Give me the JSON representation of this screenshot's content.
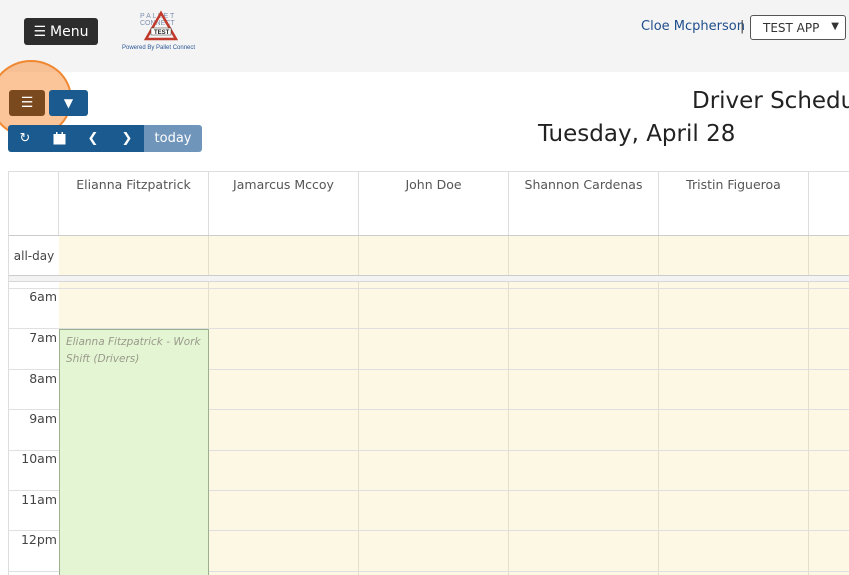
{
  "header": {
    "menu_label": "Menu",
    "logo_lines": [
      "PALLET",
      "CONNECT",
      "TEST"
    ],
    "logo_caption": "Powered By Pallet Connect",
    "user_name": "Cloe Mcpherson",
    "separator": "|",
    "app_select": {
      "selected": "TEST APP"
    }
  },
  "toolbar": {
    "list_icon": "list-icon",
    "filter_icon": "filter-icon",
    "refresh_icon": "refresh-icon",
    "calendar_icon": "calendar-icon",
    "prev_icon": "chevron-left-icon",
    "next_icon": "chevron-right-icon",
    "today_label": "today"
  },
  "page_title": "Driver Schedule",
  "date_title": "Tuesday, April 28",
  "calendar": {
    "resources": [
      "Elianna Fitzpatrick",
      "Jamarcus Mccoy",
      "John Doe",
      "Shannon Cardenas",
      "Tristin Figueroa"
    ],
    "allday_label": "all-day",
    "times": [
      "6am",
      "7am",
      "8am",
      "9am",
      "10am",
      "11am",
      "12pm"
    ],
    "event": {
      "title": "Elianna Fitzpatrick - Work Shift (Drivers)"
    }
  },
  "colors": {
    "primary": "#1a5a8e",
    "today_button": "#6f95bb",
    "list_button": "#7a4a1e",
    "menu_button": "#2d2d2d",
    "cell_background": "#fdf8e4",
    "event_background": "#e4f5d4",
    "highlight": "#f79646"
  }
}
